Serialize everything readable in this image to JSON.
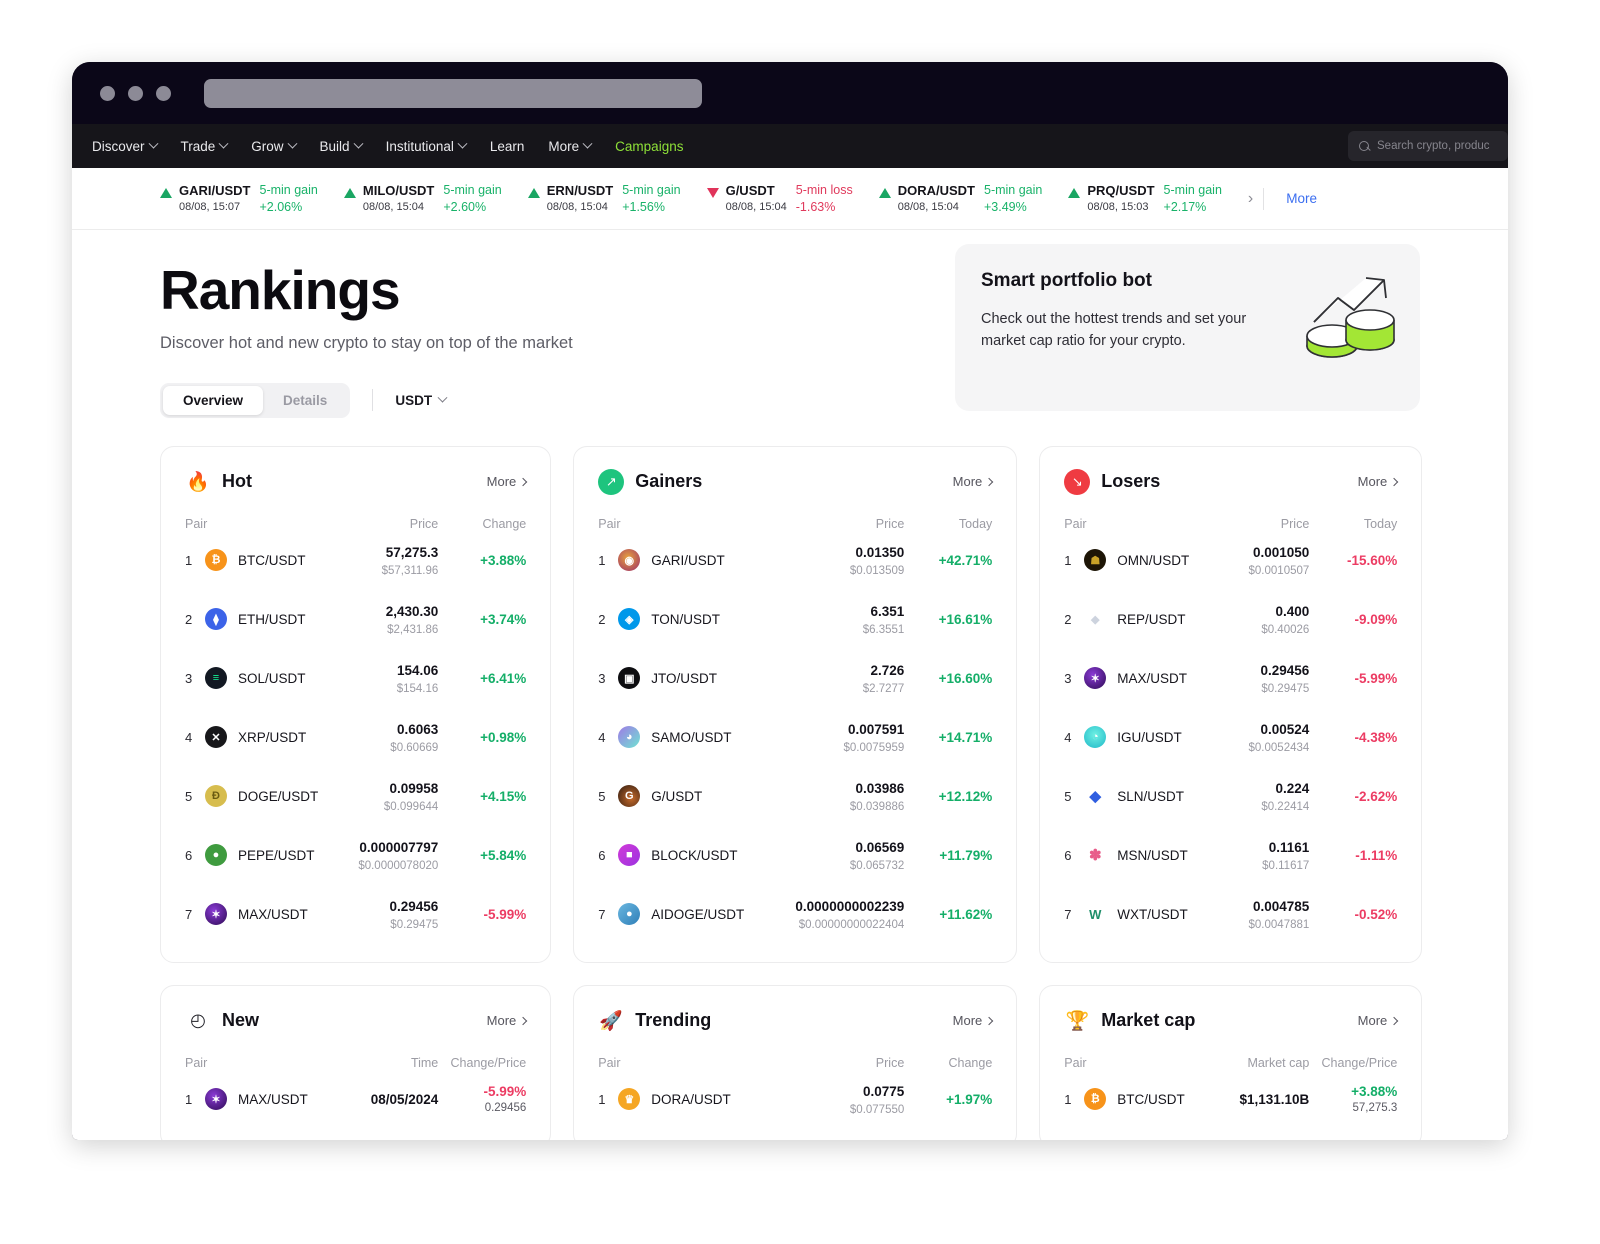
{
  "browser": {
    "url_value": ""
  },
  "nav": {
    "items": [
      {
        "label": "Discover",
        "caret": true,
        "accent": false
      },
      {
        "label": "Trade",
        "caret": true,
        "accent": false
      },
      {
        "label": "Grow",
        "caret": true,
        "accent": false
      },
      {
        "label": "Build",
        "caret": true,
        "accent": false
      },
      {
        "label": "Institutional",
        "caret": true,
        "accent": false
      },
      {
        "label": "Learn",
        "caret": false,
        "accent": false
      },
      {
        "label": "More",
        "caret": true,
        "accent": false
      },
      {
        "label": "Campaigns",
        "caret": false,
        "accent": true
      }
    ],
    "search_placeholder": "Search crypto, produc"
  },
  "ticker": {
    "items": [
      {
        "dir": "up",
        "pair": "GARI/USDT",
        "time": "08/08, 15:07",
        "label": "5-min gain",
        "value": "+2.06%"
      },
      {
        "dir": "up",
        "pair": "MILO/USDT",
        "time": "08/08, 15:04",
        "label": "5-min gain",
        "value": "+2.60%"
      },
      {
        "dir": "up",
        "pair": "ERN/USDT",
        "time": "08/08, 15:04",
        "label": "5-min gain",
        "value": "+1.56%"
      },
      {
        "dir": "down",
        "pair": "G/USDT",
        "time": "08/08, 15:04",
        "label": "5-min loss",
        "value": "-1.63%"
      },
      {
        "dir": "up",
        "pair": "DORA/USDT",
        "time": "08/08, 15:04",
        "label": "5-min gain",
        "value": "+3.49%"
      },
      {
        "dir": "up",
        "pair": "PRQ/USDT",
        "time": "08/08, 15:03",
        "label": "5-min gain",
        "value": "+2.17%"
      }
    ],
    "next_arrow": "›",
    "more_label": "More"
  },
  "hero": {
    "title": "Rankings",
    "subtitle": "Discover hot and new crypto to stay on top of the market",
    "tabs": [
      {
        "label": "Overview",
        "active": true
      },
      {
        "label": "Details",
        "active": false
      }
    ],
    "currency": "USDT"
  },
  "promo": {
    "title": "Smart portfolio bot",
    "desc": "Check out the hottest trends and set your market cap ratio for your crypto."
  },
  "cards": [
    {
      "id": "hot",
      "title": "Hot",
      "icon": "fire-icon",
      "icon_glyph": "🔥",
      "icon_bg": "transparent",
      "more_label": "More",
      "headers": {
        "pair": "Pair",
        "mid": "Price",
        "end": "Change"
      },
      "rows": [
        {
          "n": "1",
          "sym": "BTC",
          "pair": "BTC/USDT",
          "price": "57,275.3",
          "usd": "$57,311.96",
          "change": "+3.88%",
          "dir": "up",
          "c1": "#f7931a",
          "c2": "#f7931a",
          "g": "₿"
        },
        {
          "n": "2",
          "sym": "ETH",
          "pair": "ETH/USDT",
          "price": "2,430.30",
          "usd": "$2,431.86",
          "change": "+3.74%",
          "dir": "up",
          "c1": "#3c63e8",
          "c2": "#3c63e8",
          "g": "⧫"
        },
        {
          "n": "3",
          "sym": "SOL",
          "pair": "SOL/USDT",
          "price": "154.06",
          "usd": "$154.16",
          "change": "+6.41%",
          "dir": "up",
          "c1": "#121822",
          "c2": "#14f195",
          "g": "≡"
        },
        {
          "n": "4",
          "sym": "XRP",
          "pair": "XRP/USDT",
          "price": "0.6063",
          "usd": "$0.60669",
          "change": "+0.98%",
          "dir": "up",
          "c1": "#17171a",
          "c2": "#17171a",
          "g": "✕"
        },
        {
          "n": "5",
          "sym": "DOGE",
          "pair": "DOGE/USDT",
          "price": "0.09958",
          "usd": "$0.099644",
          "change": "+4.15%",
          "dir": "up",
          "c1": "#d7bd4e",
          "c2": "#d7bd4e",
          "g": "Ð"
        },
        {
          "n": "6",
          "sym": "PEPE",
          "pair": "PEPE/USDT",
          "price": "0.000007797",
          "usd": "$0.0000078020",
          "change": "+5.84%",
          "dir": "up",
          "c1": "#3f9b3f",
          "c2": "#3f9b3f",
          "g": "●"
        },
        {
          "n": "7",
          "sym": "MAX",
          "pair": "MAX/USDT",
          "price": "0.29456",
          "usd": "$0.29475",
          "change": "-5.99%",
          "dir": "down",
          "c1": "#2c0a52",
          "c2": "#8b3bd6",
          "g": "✶"
        }
      ]
    },
    {
      "id": "gainers",
      "title": "Gainers",
      "icon": "trend-up-icon",
      "icon_glyph": "↗",
      "icon_bg": "#1ec47e",
      "more_label": "More",
      "headers": {
        "pair": "Pair",
        "mid": "Price",
        "end": "Today"
      },
      "rows": [
        {
          "n": "1",
          "sym": "GARI",
          "pair": "GARI/USDT",
          "price": "0.01350",
          "usd": "$0.013509",
          "change": "+42.71%",
          "dir": "up",
          "c1": "#9a2b6a",
          "c2": "#e8a33d",
          "g": "◉"
        },
        {
          "n": "2",
          "sym": "TON",
          "pair": "TON/USDT",
          "price": "6.351",
          "usd": "$6.3551",
          "change": "+16.61%",
          "dir": "up",
          "c1": "#0098ea",
          "c2": "#0098ea",
          "g": "◈"
        },
        {
          "n": "3",
          "sym": "JTO",
          "pair": "JTO/USDT",
          "price": "2.726",
          "usd": "$2.7277",
          "change": "+16.60%",
          "dir": "up",
          "c1": "#0d0d10",
          "c2": "#0d0d10",
          "g": "▣"
        },
        {
          "n": "4",
          "sym": "SAMO",
          "pair": "SAMO/USDT",
          "price": "0.007591",
          "usd": "$0.0075959",
          "change": "+14.71%",
          "dir": "up",
          "c1": "#9f7ae6",
          "c2": "#6fe3d2",
          "g": "◕"
        },
        {
          "n": "5",
          "sym": "G",
          "pair": "G/USDT",
          "price": "0.03986",
          "usd": "$0.039886",
          "change": "+12.12%",
          "dir": "up",
          "c1": "#45301f",
          "c2": "#c4692a",
          "g": "G"
        },
        {
          "n": "6",
          "sym": "BLOCK",
          "pair": "BLOCK/USDT",
          "price": "0.06569",
          "usd": "$0.065732",
          "change": "+11.79%",
          "dir": "up",
          "c1": "#d13ad8",
          "c2": "#9c33e0",
          "g": "■"
        },
        {
          "n": "7",
          "sym": "AIDOGE",
          "pair": "AIDOGE/USDT",
          "price": "0.0000000002239",
          "usd": "$0.00000000022404",
          "change": "+11.62%",
          "dir": "up",
          "c1": "#6bb7e0",
          "c2": "#2f7fb8",
          "g": "●"
        }
      ]
    },
    {
      "id": "losers",
      "title": "Losers",
      "icon": "trend-down-icon",
      "icon_glyph": "↘",
      "icon_bg": "#ef3b42",
      "more_label": "More",
      "headers": {
        "pair": "Pair",
        "mid": "Price",
        "end": "Today"
      },
      "rows": [
        {
          "n": "1",
          "sym": "OMN",
          "pair": "OMN/USDT",
          "price": "0.001050",
          "usd": "$0.0010507",
          "change": "-15.60%",
          "dir": "down",
          "c1": "#1d1506",
          "c2": "#c9a227",
          "g": "☗"
        },
        {
          "n": "2",
          "sym": "REP",
          "pair": "REP/USDT",
          "price": "0.400",
          "usd": "$0.40026",
          "change": "-9.09%",
          "dir": "down",
          "c1": "#eef0f4",
          "c2": "#d3d8e2",
          "g": "◆"
        },
        {
          "n": "3",
          "sym": "MAX",
          "pair": "MAX/USDT",
          "price": "0.29456",
          "usd": "$0.29475",
          "change": "-5.99%",
          "dir": "down",
          "c1": "#2c0a52",
          "c2": "#8b3bd6",
          "g": "✶"
        },
        {
          "n": "4",
          "sym": "IGU",
          "pair": "IGU/USDT",
          "price": "0.00524",
          "usd": "$0.0052434",
          "change": "-4.38%",
          "dir": "down",
          "c1": "#25d4c9",
          "c2": "#1fb8c8",
          "g": "◔"
        },
        {
          "n": "5",
          "sym": "SLN",
          "pair": "SLN/USDT",
          "price": "0.224",
          "usd": "$0.22414",
          "change": "-2.62%",
          "dir": "down",
          "c1": "#2f5ee0",
          "c2": "#2f5ee0",
          "g": "◆"
        },
        {
          "n": "6",
          "sym": "MSN",
          "pair": "MSN/USDT",
          "price": "0.1161",
          "usd": "$0.11617",
          "change": "-1.11%",
          "dir": "down",
          "c1": "#ffffff",
          "c2": "#ffffff",
          "g": "✽"
        },
        {
          "n": "7",
          "sym": "WXT",
          "pair": "WXT/USDT",
          "price": "0.004785",
          "usd": "$0.0047881",
          "change": "-0.52%",
          "dir": "down",
          "c1": "#ffffff",
          "c2": "#ffffff",
          "g": "W"
        }
      ]
    },
    {
      "id": "new",
      "title": "New",
      "icon": "clock-icon",
      "icon_glyph": "◴",
      "icon_bg": "transparent",
      "more_label": "More",
      "headers": {
        "pair": "Pair",
        "mid": "Time",
        "end": "Change/Price"
      },
      "rows": [
        {
          "n": "1",
          "sym": "MAX",
          "pair": "MAX/USDT",
          "price": "08/05/2024",
          "usd": "",
          "change": "-5.99%",
          "change2": "0.29456",
          "dir": "down",
          "c1": "#2c0a52",
          "c2": "#8b3bd6",
          "g": "✶"
        }
      ]
    },
    {
      "id": "trending",
      "title": "Trending",
      "icon": "rocket-icon",
      "icon_glyph": "🚀",
      "icon_bg": "transparent",
      "more_label": "More",
      "headers": {
        "pair": "Pair",
        "mid": "Price",
        "end": "Change"
      },
      "rows": [
        {
          "n": "1",
          "sym": "DORA",
          "pair": "DORA/USDT",
          "price": "0.0775",
          "usd": "$0.077550",
          "change": "+1.97%",
          "dir": "up",
          "c1": "#f5a623",
          "c2": "#f5a623",
          "g": "♛"
        }
      ]
    },
    {
      "id": "marketcap",
      "title": "Market cap",
      "icon": "trophy-icon",
      "icon_glyph": "🏆",
      "icon_bg": "transparent",
      "more_label": "More",
      "headers": {
        "pair": "Pair",
        "mid": "Market cap",
        "end": "Change/Price"
      },
      "rows": [
        {
          "n": "1",
          "sym": "BTC",
          "pair": "BTC/USDT",
          "price": "$1,131.10B",
          "usd": "",
          "change": "+3.88%",
          "change2": "57,275.3",
          "dir": "up",
          "c1": "#f7931a",
          "c2": "#f7931a",
          "g": "₿"
        }
      ]
    }
  ],
  "colors": {
    "green": "#14ae68",
    "red": "#ec3c63",
    "accent_nav": "#8ee038",
    "link_blue": "#3b6ef0"
  }
}
